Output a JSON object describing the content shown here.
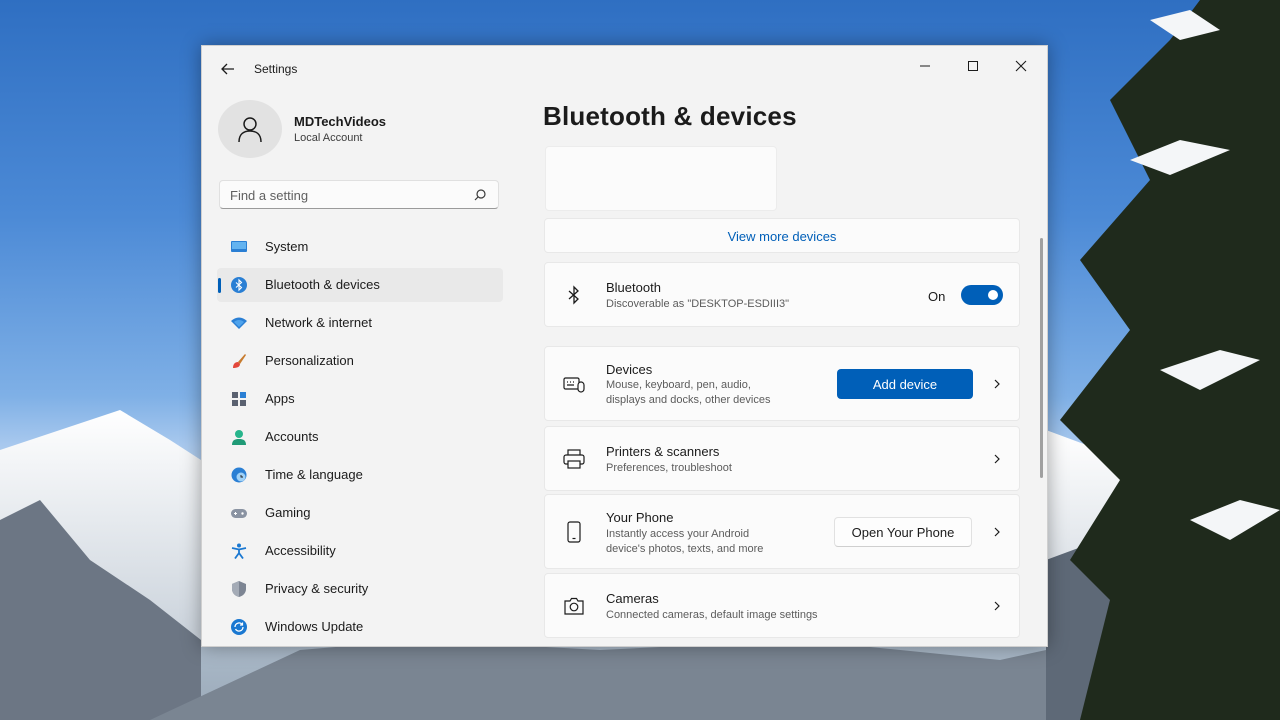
{
  "window": {
    "app_title": "Settings"
  },
  "account": {
    "name": "MDTechVideos",
    "type": "Local Account"
  },
  "search": {
    "placeholder": "Find a setting"
  },
  "nav": {
    "items": [
      {
        "label": "System",
        "icon": "monitor-icon"
      },
      {
        "label": "Bluetooth & devices",
        "icon": "bluetooth-icon",
        "active": true
      },
      {
        "label": "Network & internet",
        "icon": "wifi-icon"
      },
      {
        "label": "Personalization",
        "icon": "brush-icon"
      },
      {
        "label": "Apps",
        "icon": "apps-icon"
      },
      {
        "label": "Accounts",
        "icon": "person-icon"
      },
      {
        "label": "Time & language",
        "icon": "globe-clock-icon"
      },
      {
        "label": "Gaming",
        "icon": "gamepad-icon"
      },
      {
        "label": "Accessibility",
        "icon": "accessibility-icon"
      },
      {
        "label": "Privacy & security",
        "icon": "shield-icon"
      },
      {
        "label": "Windows Update",
        "icon": "update-icon"
      }
    ]
  },
  "main": {
    "title": "Bluetooth & devices",
    "view_more": "View more devices",
    "bluetooth": {
      "title": "Bluetooth",
      "subtitle": "Discoverable as \"DESKTOP-ESDIII3\"",
      "state": "On"
    },
    "devices": {
      "title": "Devices",
      "subtitle_line1": "Mouse, keyboard, pen, audio,",
      "subtitle_line2": "displays and docks, other devices",
      "button": "Add device"
    },
    "printers": {
      "title": "Printers & scanners",
      "subtitle": "Preferences, troubleshoot"
    },
    "phone": {
      "title": "Your Phone",
      "subtitle_line1": "Instantly access your Android",
      "subtitle_line2": "device's photos, texts, and more",
      "button": "Open Your Phone"
    },
    "cameras": {
      "title": "Cameras",
      "subtitle": "Connected cameras, default image settings"
    }
  },
  "colors": {
    "accent": "#005fb8",
    "window_bg": "#f3f3f3",
    "card_bg": "#fbfbfb"
  }
}
